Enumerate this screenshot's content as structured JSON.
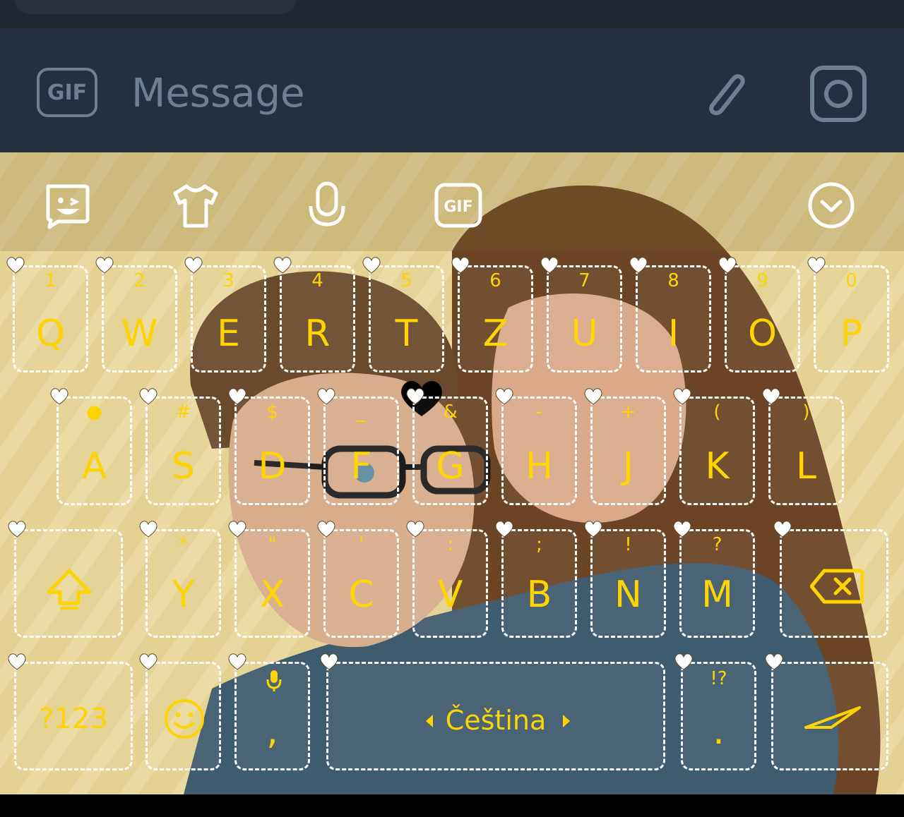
{
  "composer": {
    "gif_label": "GIF",
    "message_placeholder": "Message"
  },
  "toolbar": {
    "icons": [
      "sticker-icon",
      "tshirt-icon",
      "microphone-icon",
      "gif-icon",
      "collapse-chevron-icon"
    ],
    "gif_label": "GIF"
  },
  "keyboard": {
    "row1": [
      {
        "key": "Q",
        "hint": "1"
      },
      {
        "key": "W",
        "hint": "2"
      },
      {
        "key": "E",
        "hint": "3"
      },
      {
        "key": "R",
        "hint": "4"
      },
      {
        "key": "T",
        "hint": "5"
      },
      {
        "key": "Z",
        "hint": "6"
      },
      {
        "key": "U",
        "hint": "7"
      },
      {
        "key": "I",
        "hint": "8"
      },
      {
        "key": "O",
        "hint": "9"
      },
      {
        "key": "P",
        "hint": "0"
      }
    ],
    "row2": [
      {
        "key": "A",
        "hint": "●"
      },
      {
        "key": "S",
        "hint": "#"
      },
      {
        "key": "D",
        "hint": "$"
      },
      {
        "key": "F",
        "hint": "_"
      },
      {
        "key": "G",
        "hint": "&"
      },
      {
        "key": "H",
        "hint": "-"
      },
      {
        "key": "J",
        "hint": "+"
      },
      {
        "key": "K",
        "hint": "("
      },
      {
        "key": "L",
        "hint": ")"
      }
    ],
    "row3": [
      {
        "key": "Y",
        "hint": "*"
      },
      {
        "key": "X",
        "hint": "\""
      },
      {
        "key": "C",
        "hint": "'"
      },
      {
        "key": "V",
        "hint": ":"
      },
      {
        "key": "B",
        "hint": ";"
      },
      {
        "key": "N",
        "hint": "!"
      },
      {
        "key": "M",
        "hint": "?"
      }
    ],
    "symbols_label": "?123",
    "comma_label": ",",
    "space_label": "Čeština",
    "period_label": ".",
    "period_hint": "!?"
  },
  "colors": {
    "key_text": "#ffd400",
    "key_border": "#ffffff",
    "composer_bg": "#243040",
    "keyboard_bg": "#e0cf8c"
  }
}
